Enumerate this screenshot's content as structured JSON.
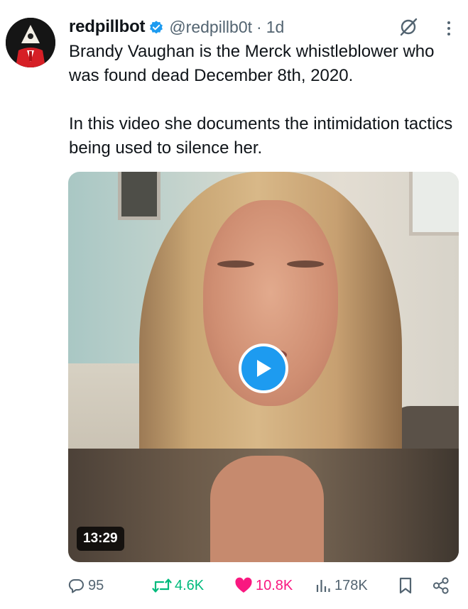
{
  "tweet": {
    "author_name": "redpillbot",
    "handle": "@redpillb0t",
    "separator": "·",
    "time": "1d",
    "text": "Brandy Vaughan is the Merck whistleblower who was found dead December 8th, 2020.\n\nIn this video she documents the intimidation tactics being used to silence her."
  },
  "media": {
    "duration": "13:29"
  },
  "stats": {
    "replies": "95",
    "retweets": "4.6K",
    "likes": "10.8K",
    "views": "178K"
  },
  "colors": {
    "text": "#0f1419",
    "secondary": "#536471",
    "accent": "#1d9bf0",
    "retweet": "#00ba7c",
    "like": "#f91880"
  },
  "icons": {
    "verified": "verified-badge-icon",
    "grok": "grok-icon",
    "more": "more-dots-icon",
    "play": "play-icon",
    "reply": "reply-icon",
    "retweet": "retweet-icon",
    "like": "heart-icon",
    "views": "views-chart-icon",
    "bookmark": "bookmark-icon",
    "share": "share-icon"
  }
}
